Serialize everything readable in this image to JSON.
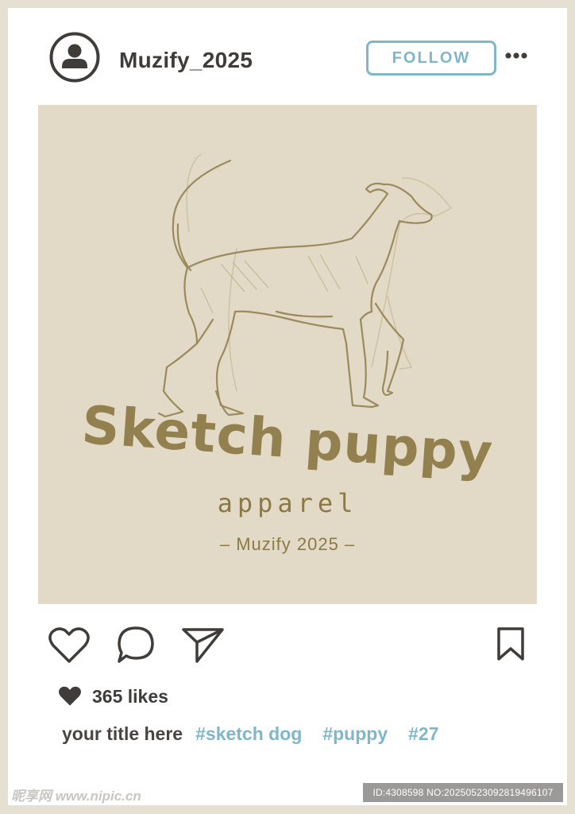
{
  "post": {
    "username": "Muzify_2025",
    "follow_label": "FOLLOW",
    "image": {
      "title": "Sketch puppy",
      "subtitle": "apparel",
      "credit": "– Muzify 2025 –"
    },
    "likes": "365 likes",
    "caption_title": "your title here",
    "hashtags": [
      "#sketch dog",
      "#puppy",
      "#27"
    ]
  },
  "icons": {
    "avatar": "user-avatar-icon",
    "more": "more-dots-icon",
    "like": "heart-icon",
    "comment": "comment-icon",
    "share": "send-icon",
    "save": "bookmark-icon",
    "likes": "filled-heart-icon"
  },
  "colors": {
    "background_frame": "#e6e0d2",
    "image_background": "#e2dac7",
    "brand_olive": "#8c7a45",
    "accent_blue": "#7fb7c9",
    "text_dark": "#3f3c3a"
  },
  "watermark": {
    "site": "昵享网 www.nipic.cn",
    "id_text": "ID:4308598 NO:20250523092819496107"
  }
}
